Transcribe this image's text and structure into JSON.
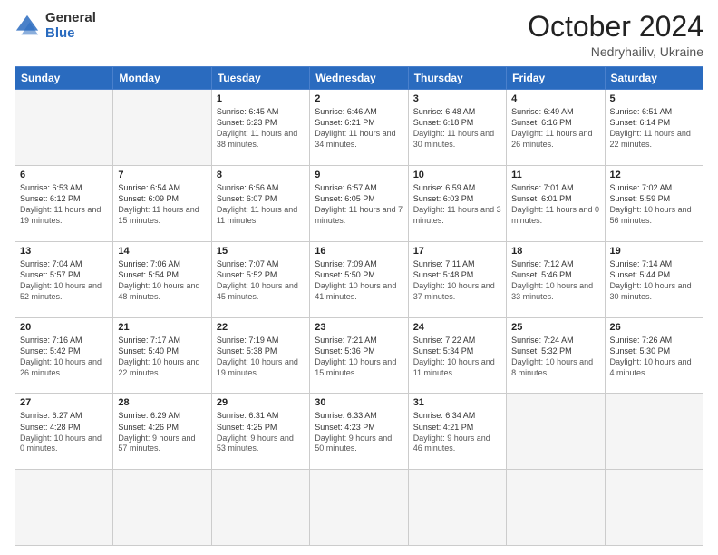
{
  "logo": {
    "general": "General",
    "blue": "Blue"
  },
  "header": {
    "month": "October 2024",
    "location": "Nedryhailiv, Ukraine"
  },
  "weekdays": [
    "Sunday",
    "Monday",
    "Tuesday",
    "Wednesday",
    "Thursday",
    "Friday",
    "Saturday"
  ],
  "days": [
    {
      "num": "",
      "sunrise": "",
      "sunset": "",
      "daylight": "",
      "empty": true
    },
    {
      "num": "",
      "sunrise": "",
      "sunset": "",
      "daylight": "",
      "empty": true
    },
    {
      "num": "1",
      "sunrise": "Sunrise: 6:45 AM",
      "sunset": "Sunset: 6:23 PM",
      "daylight": "Daylight: 11 hours and 38 minutes."
    },
    {
      "num": "2",
      "sunrise": "Sunrise: 6:46 AM",
      "sunset": "Sunset: 6:21 PM",
      "daylight": "Daylight: 11 hours and 34 minutes."
    },
    {
      "num": "3",
      "sunrise": "Sunrise: 6:48 AM",
      "sunset": "Sunset: 6:18 PM",
      "daylight": "Daylight: 11 hours and 30 minutes."
    },
    {
      "num": "4",
      "sunrise": "Sunrise: 6:49 AM",
      "sunset": "Sunset: 6:16 PM",
      "daylight": "Daylight: 11 hours and 26 minutes."
    },
    {
      "num": "5",
      "sunrise": "Sunrise: 6:51 AM",
      "sunset": "Sunset: 6:14 PM",
      "daylight": "Daylight: 11 hours and 22 minutes."
    },
    {
      "num": "6",
      "sunrise": "Sunrise: 6:53 AM",
      "sunset": "Sunset: 6:12 PM",
      "daylight": "Daylight: 11 hours and 19 minutes."
    },
    {
      "num": "7",
      "sunrise": "Sunrise: 6:54 AM",
      "sunset": "Sunset: 6:09 PM",
      "daylight": "Daylight: 11 hours and 15 minutes."
    },
    {
      "num": "8",
      "sunrise": "Sunrise: 6:56 AM",
      "sunset": "Sunset: 6:07 PM",
      "daylight": "Daylight: 11 hours and 11 minutes."
    },
    {
      "num": "9",
      "sunrise": "Sunrise: 6:57 AM",
      "sunset": "Sunset: 6:05 PM",
      "daylight": "Daylight: 11 hours and 7 minutes."
    },
    {
      "num": "10",
      "sunrise": "Sunrise: 6:59 AM",
      "sunset": "Sunset: 6:03 PM",
      "daylight": "Daylight: 11 hours and 3 minutes."
    },
    {
      "num": "11",
      "sunrise": "Sunrise: 7:01 AM",
      "sunset": "Sunset: 6:01 PM",
      "daylight": "Daylight: 11 hours and 0 minutes."
    },
    {
      "num": "12",
      "sunrise": "Sunrise: 7:02 AM",
      "sunset": "Sunset: 5:59 PM",
      "daylight": "Daylight: 10 hours and 56 minutes."
    },
    {
      "num": "13",
      "sunrise": "Sunrise: 7:04 AM",
      "sunset": "Sunset: 5:57 PM",
      "daylight": "Daylight: 10 hours and 52 minutes."
    },
    {
      "num": "14",
      "sunrise": "Sunrise: 7:06 AM",
      "sunset": "Sunset: 5:54 PM",
      "daylight": "Daylight: 10 hours and 48 minutes."
    },
    {
      "num": "15",
      "sunrise": "Sunrise: 7:07 AM",
      "sunset": "Sunset: 5:52 PM",
      "daylight": "Daylight: 10 hours and 45 minutes."
    },
    {
      "num": "16",
      "sunrise": "Sunrise: 7:09 AM",
      "sunset": "Sunset: 5:50 PM",
      "daylight": "Daylight: 10 hours and 41 minutes."
    },
    {
      "num": "17",
      "sunrise": "Sunrise: 7:11 AM",
      "sunset": "Sunset: 5:48 PM",
      "daylight": "Daylight: 10 hours and 37 minutes."
    },
    {
      "num": "18",
      "sunrise": "Sunrise: 7:12 AM",
      "sunset": "Sunset: 5:46 PM",
      "daylight": "Daylight: 10 hours and 33 minutes."
    },
    {
      "num": "19",
      "sunrise": "Sunrise: 7:14 AM",
      "sunset": "Sunset: 5:44 PM",
      "daylight": "Daylight: 10 hours and 30 minutes."
    },
    {
      "num": "20",
      "sunrise": "Sunrise: 7:16 AM",
      "sunset": "Sunset: 5:42 PM",
      "daylight": "Daylight: 10 hours and 26 minutes."
    },
    {
      "num": "21",
      "sunrise": "Sunrise: 7:17 AM",
      "sunset": "Sunset: 5:40 PM",
      "daylight": "Daylight: 10 hours and 22 minutes."
    },
    {
      "num": "22",
      "sunrise": "Sunrise: 7:19 AM",
      "sunset": "Sunset: 5:38 PM",
      "daylight": "Daylight: 10 hours and 19 minutes."
    },
    {
      "num": "23",
      "sunrise": "Sunrise: 7:21 AM",
      "sunset": "Sunset: 5:36 PM",
      "daylight": "Daylight: 10 hours and 15 minutes."
    },
    {
      "num": "24",
      "sunrise": "Sunrise: 7:22 AM",
      "sunset": "Sunset: 5:34 PM",
      "daylight": "Daylight: 10 hours and 11 minutes."
    },
    {
      "num": "25",
      "sunrise": "Sunrise: 7:24 AM",
      "sunset": "Sunset: 5:32 PM",
      "daylight": "Daylight: 10 hours and 8 minutes."
    },
    {
      "num": "26",
      "sunrise": "Sunrise: 7:26 AM",
      "sunset": "Sunset: 5:30 PM",
      "daylight": "Daylight: 10 hours and 4 minutes."
    },
    {
      "num": "27",
      "sunrise": "Sunrise: 6:27 AM",
      "sunset": "Sunset: 4:28 PM",
      "daylight": "Daylight: 10 hours and 0 minutes."
    },
    {
      "num": "28",
      "sunrise": "Sunrise: 6:29 AM",
      "sunset": "Sunset: 4:26 PM",
      "daylight": "Daylight: 9 hours and 57 minutes."
    },
    {
      "num": "29",
      "sunrise": "Sunrise: 6:31 AM",
      "sunset": "Sunset: 4:25 PM",
      "daylight": "Daylight: 9 hours and 53 minutes."
    },
    {
      "num": "30",
      "sunrise": "Sunrise: 6:33 AM",
      "sunset": "Sunset: 4:23 PM",
      "daylight": "Daylight: 9 hours and 50 minutes."
    },
    {
      "num": "31",
      "sunrise": "Sunrise: 6:34 AM",
      "sunset": "Sunset: 4:21 PM",
      "daylight": "Daylight: 9 hours and 46 minutes."
    },
    {
      "num": "",
      "sunrise": "",
      "sunset": "",
      "daylight": "",
      "empty": true
    },
    {
      "num": "",
      "sunrise": "",
      "sunset": "",
      "daylight": "",
      "empty": true
    }
  ]
}
